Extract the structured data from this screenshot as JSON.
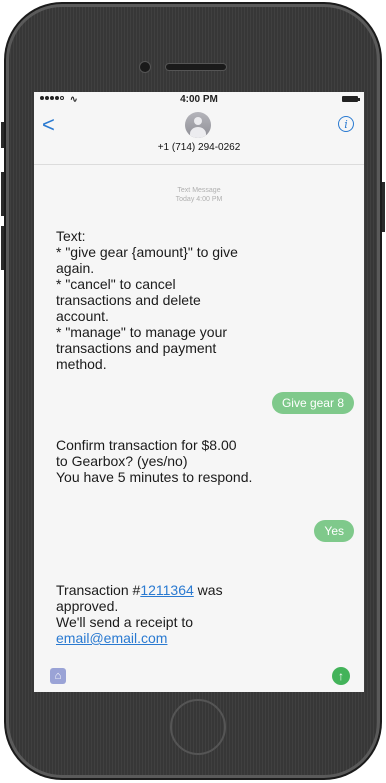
{
  "status_bar": {
    "time": "4:00 PM"
  },
  "header": {
    "back_icon": "chevron-left-icon",
    "back_glyph": "<",
    "contact_number": "+1 (714) 294-0262",
    "info_icon": "info-icon",
    "info_glyph": "i"
  },
  "thread": {
    "service_label": "Text Message",
    "date_label": "Today 4:00 PM"
  },
  "messages": [
    {
      "direction": "incoming",
      "text": "Text:\n* \"give gear {amount}\" to give\nagain.\n* \"cancel\" to cancel\ntransactions and delete\naccount.\n* \"manage\" to manage your\ntransactions and payment\nmethod."
    },
    {
      "direction": "outgoing",
      "text": "Give gear 8"
    },
    {
      "direction": "incoming",
      "text": "Confirm transaction for $8.00\nto Gearbox? (yes/no)\nYou have 5 minutes to respond."
    },
    {
      "direction": "outgoing",
      "text": "Yes"
    },
    {
      "direction": "incoming",
      "prefix": "Transaction #",
      "transaction_id": "1211364",
      "middle": " was\napproved.\nWe'll send a receipt to\n",
      "email": "email@email.com"
    }
  ],
  "input_bar": {
    "apps_icon": "app-store-icon",
    "apps_glyph": "⌂",
    "send_icon": "send-arrow-icon",
    "send_glyph": "↑"
  },
  "colors": {
    "outgoing_bubble": "#7fc98b",
    "link": "#2a7ad1",
    "send_button": "#43b35a"
  }
}
